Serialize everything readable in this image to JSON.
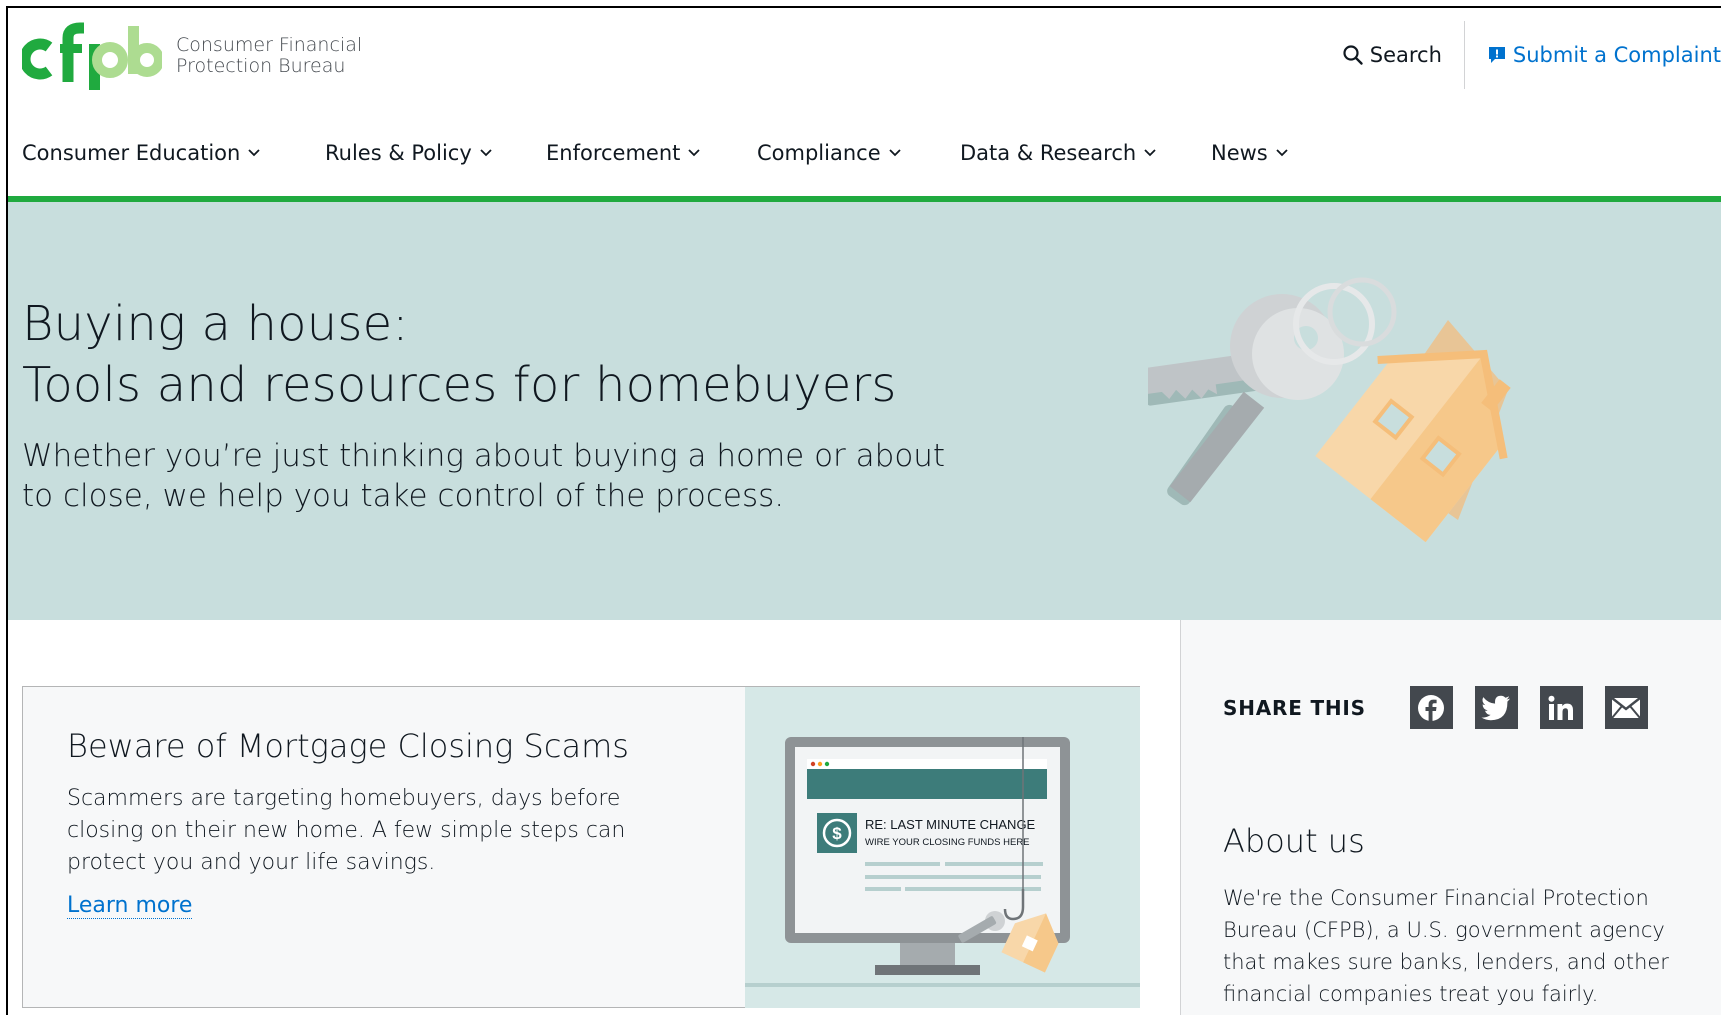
{
  "brand": {
    "logo_letters": "cfpb",
    "line1": "Consumer Financial",
    "line2": "Protection Bureau",
    "green": "#20aa3f",
    "light_green": "#addc91"
  },
  "utility": {
    "search_label": "Search",
    "complaint_label": "Submit a Complaint"
  },
  "nav": {
    "items": [
      {
        "label": "Consumer Education"
      },
      {
        "label": "Rules & Policy"
      },
      {
        "label": "Enforcement"
      },
      {
        "label": "Compliance"
      },
      {
        "label": "Data & Research"
      },
      {
        "label": "News"
      }
    ]
  },
  "hero": {
    "title_line1": "Buying a house:",
    "title_line2": "Tools and resources for homebuyers",
    "lead": "Whether you’re just thinking about buying a home or about to close, we help you take control of the process."
  },
  "featured": {
    "title": "Beware of Mortgage Closing Scams",
    "body": "Scammers are targeting homebuyers, days before closing on their new home. A few simple steps can protect you and your life savings.",
    "link": "Learn more",
    "image_headline": "RE: LAST MINUTE CHANGE",
    "image_subline": "WIRE YOUR CLOSING FUNDS HERE"
  },
  "sidebar": {
    "share_label": "SHARE THIS",
    "share_icons": [
      "facebook-icon",
      "twitter-icon",
      "linkedin-icon",
      "email-icon"
    ],
    "about_heading": "About us",
    "about_body": "We're the Consumer Financial Protection Bureau (CFPB), a U.S. government agency that makes sure banks, lenders, and other financial companies treat you fairly."
  },
  "colors": {
    "hero_bg": "#c8dedd",
    "link_blue": "#0072ce",
    "text": "#101820"
  }
}
